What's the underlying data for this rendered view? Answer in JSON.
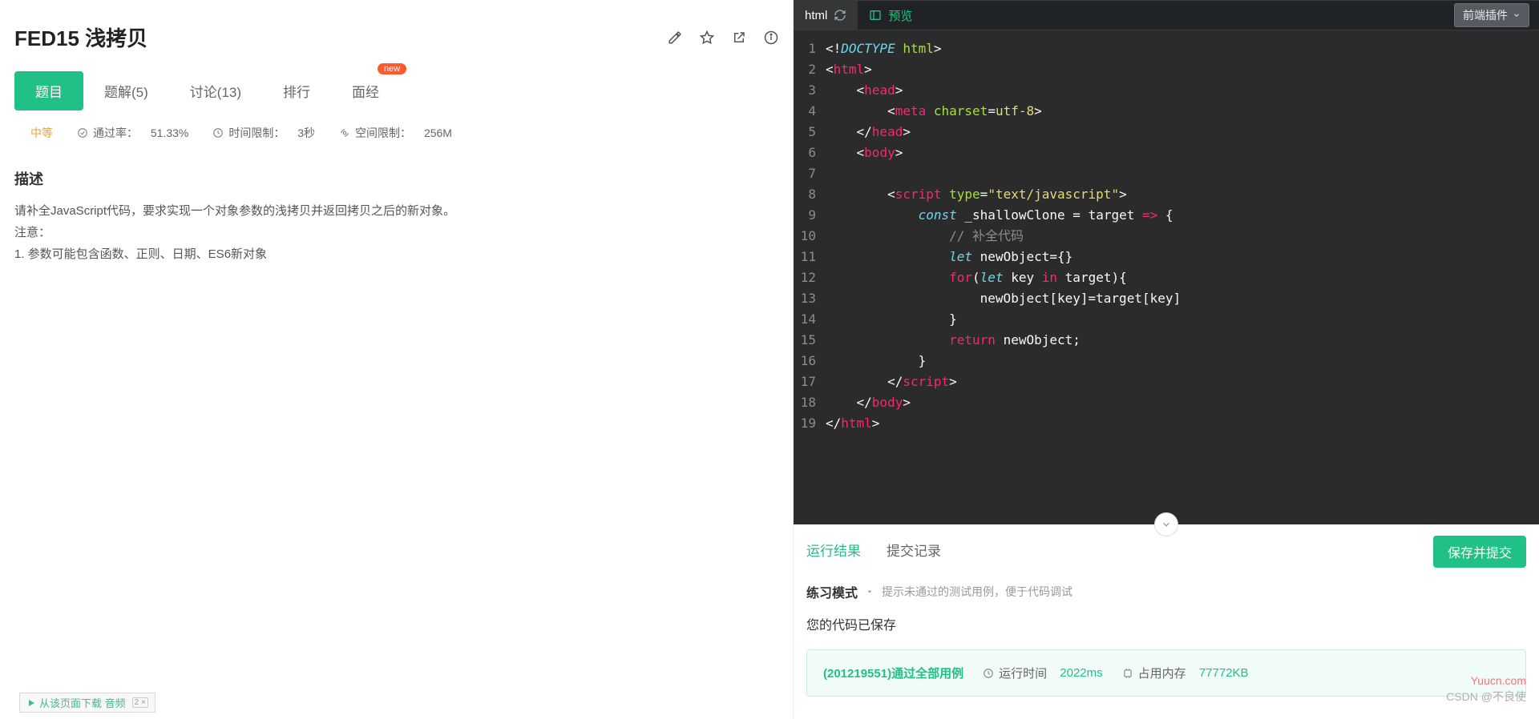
{
  "problem": {
    "code": "FED15",
    "title": "浅拷贝",
    "full": "FED15  浅拷贝"
  },
  "toolbar": {
    "edit": "✎",
    "star": "☆",
    "share": "↗",
    "info": "ⓘ"
  },
  "tabs": {
    "items": [
      {
        "label": "题目"
      },
      {
        "label": "题解(5)"
      },
      {
        "label": "讨论(13)"
      },
      {
        "label": "排行"
      },
      {
        "label": "面经",
        "badge": "new"
      }
    ]
  },
  "meta": {
    "difficulty": "中等",
    "pass_label": "通过率：",
    "pass_value": "51.33%",
    "time_label": "时间限制：",
    "time_value": "3秒",
    "space_label": "空间限制：",
    "space_value": "256M"
  },
  "desc": {
    "heading": "描述",
    "p1": "请补全JavaScript代码，要求实现一个对象参数的浅拷贝并返回拷贝之后的新对象。",
    "p2": "注意：",
    "p3": "1. 参数可能包含函数、正则、日期、ES6新对象"
  },
  "audio": {
    "label": "从该页面下载 音频",
    "count": "2"
  },
  "editor": {
    "tab_html": "html",
    "tab_preview": "预览",
    "plugin": "前端插件",
    "gutter": " 1\n 2\n 3\n 4\n 5\n 6\n 7\n 8\n 9\n10\n11\n12\n13\n14\n15\n16\n17\n18\n19"
  },
  "result": {
    "tab_run": "运行结果",
    "tab_history": "提交记录",
    "submit": "保存并提交",
    "mode": "练习模式",
    "mode_hint": "提示未通过的测试用例，便于代码调试",
    "saved": "您的代码已保存",
    "pass_text": "(201219551)通过全部用例",
    "runtime_label": "运行时间",
    "runtime_value": "2022ms",
    "mem_label": "占用内存",
    "mem_value": "77772KB"
  },
  "watermark": {
    "site": "Yuucn.com",
    "csdn": "CSDN @不良使"
  }
}
